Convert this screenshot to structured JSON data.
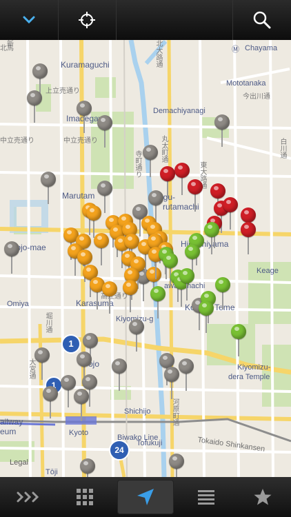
{
  "toolbar": {
    "items": [
      {
        "name": "collapse-button",
        "icon": "chevron-down-icon"
      },
      {
        "name": "locate-button",
        "icon": "crosshair-icon"
      },
      {
        "name": "search-button",
        "icon": "search-icon"
      }
    ]
  },
  "map": {
    "labels": {
      "kuramaguchi": "Kuramaguchi",
      "chayama": "Chayama",
      "mototanaka": "Mototanaka",
      "demachiyanagi": "Demachiyanagi",
      "imadegawa": "Imadegawa",
      "marutamachi_w": "Marutam",
      "marutamachi_e": "ngu-",
      "marutamachi_e2": "rutamachi",
      "nijojo_mae": "ijojo-mae",
      "higashiyama": "Higashiyama",
      "keage": "Keage",
      "omiya": "Omiya",
      "karasuma": "Karasuma",
      "kawaramachi": "awaramachi",
      "kodaiji": "Kodai-ji Tem",
      "kodaiji_end": "e",
      "kiyomizu_gojo": "Kiyomizu-g",
      "kiyomizu_temple_1": "Kiyomizu-",
      "kiyomizu_temple_2": "dera Temple",
      "gojo": "ojo",
      "shichijo": "Shichijo",
      "biwako_line": "Biwako Line",
      "tokaido": "Tokaido Shinkansen",
      "kyoto": "Kyoto",
      "railway": "ailway",
      "museum": "eum",
      "tofukuji": "Tofukuji",
      "toji": "Tōji",
      "legal": "Legal",
      "jp_kamidachiuri": "上立売通り",
      "jp_nakadachiuri": "中立売通り",
      "jp_nakadachiuri2": "中立売通り",
      "jp_takatsuji": "高辻通り",
      "jp_horikawa": "堀川通",
      "jp_omiya": "大宮通",
      "jp_imadegawa": "今出川通",
      "jp_teramachi": "寺町通り",
      "jp_higashioji": "東大路通",
      "jp_shirakawa": "白川通",
      "jp_kawaramachi": "河原町通",
      "jp_kitaoji": "北大路通",
      "jp_marutamachi": "丸太町通",
      "jp_shin": "新",
      "jp_kitamaji": "北馬"
    },
    "routes": {
      "route1": "1",
      "route24": "24"
    }
  },
  "tabbar": {
    "items": [
      {
        "name": "tab-more",
        "icon": "triple-chevron-icon"
      },
      {
        "name": "tab-grid",
        "icon": "grid-icon"
      },
      {
        "name": "tab-map",
        "icon": "location-arrow-icon"
      },
      {
        "name": "tab-list",
        "icon": "list-icon"
      },
      {
        "name": "tab-favorites",
        "icon": "star-icon"
      }
    ]
  },
  "colors": {
    "pin_gray": "#8e8a85",
    "pin_red": "#cf1e26",
    "pin_orange": "#f3a21d",
    "pin_green": "#78c033",
    "accent": "#2a8fd6"
  }
}
